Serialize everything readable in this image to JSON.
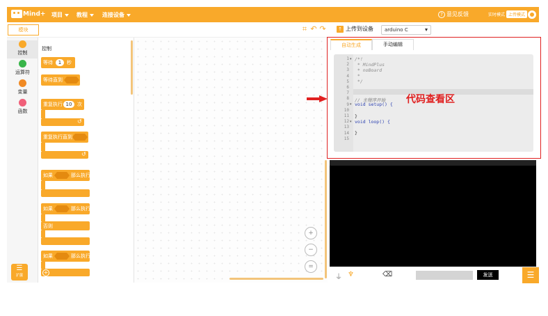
{
  "header": {
    "logo_text": "Mind+",
    "menus": [
      "项目",
      "教程",
      "连接设备"
    ],
    "feedback": "意见反馈",
    "mode_realtime": "实时模式",
    "mode_upload": "上传模式"
  },
  "toolbar": {
    "blocks_tab": "模块",
    "upload_label": "上传到设备",
    "board_selected": "arduino C"
  },
  "categories": [
    {
      "label": "控制",
      "color": "#f9a92a"
    },
    {
      "label": "运算符",
      "color": "#39b54a"
    },
    {
      "label": "变量",
      "color": "#f08a24"
    },
    {
      "label": "函数",
      "color": "#f0607a"
    }
  ],
  "extension_label": "扩展",
  "palette": {
    "title": "控制",
    "wait": {
      "pre": "等待",
      "value": "1",
      "post": "秒"
    },
    "wait_until": "等待直到",
    "repeat": {
      "pre": "重复执行",
      "value": "10",
      "post": "次"
    },
    "repeat_until": "重复执行直到",
    "if_then": {
      "pre": "如果",
      "post": "那么执行"
    },
    "if_else": {
      "pre": "如果",
      "post": "那么执行",
      "else": "否则"
    },
    "if_then2": {
      "pre": "如果",
      "post": "那么执行"
    }
  },
  "zoom": {
    "in": "+",
    "out": "−",
    "reset": "="
  },
  "code_panel": {
    "tabs": [
      "自动生成",
      "手动编辑"
    ],
    "lines": [
      {
        "n": "1",
        "fold": "▾",
        "text": "/*!",
        "cls": "cm"
      },
      {
        "n": "2",
        "fold": "",
        "text": " * MindPlus",
        "cls": "cm"
      },
      {
        "n": "3",
        "fold": "",
        "text": " * noBoard",
        "cls": "cm"
      },
      {
        "n": "4",
        "fold": "",
        "text": " *",
        "cls": "cm"
      },
      {
        "n": "5",
        "fold": "",
        "text": " */",
        "cls": "cm"
      },
      {
        "n": "6",
        "fold": "",
        "text": "",
        "cls": "plain"
      },
      {
        "n": "7",
        "fold": "",
        "text": "",
        "cls": "plain"
      },
      {
        "n": "8",
        "fold": "",
        "text": "// 主程序开始",
        "cls": "cm"
      },
      {
        "n": "9",
        "fold": "▾",
        "text": "void setup() {",
        "cls": "kw"
      },
      {
        "n": "10",
        "fold": "",
        "text": "",
        "cls": "plain"
      },
      {
        "n": "11",
        "fold": "",
        "text": "}",
        "cls": "plain"
      },
      {
        "n": "12",
        "fold": "▾",
        "text": "void loop() {",
        "cls": "kw"
      },
      {
        "n": "13",
        "fold": "",
        "text": "",
        "cls": "plain"
      },
      {
        "n": "14",
        "fold": "",
        "text": "}",
        "cls": "plain"
      },
      {
        "n": "15",
        "fold": "",
        "text": "",
        "cls": "plain"
      }
    ]
  },
  "annotation": {
    "label": "代码查看区"
  },
  "serial": {
    "send": "发送"
  }
}
